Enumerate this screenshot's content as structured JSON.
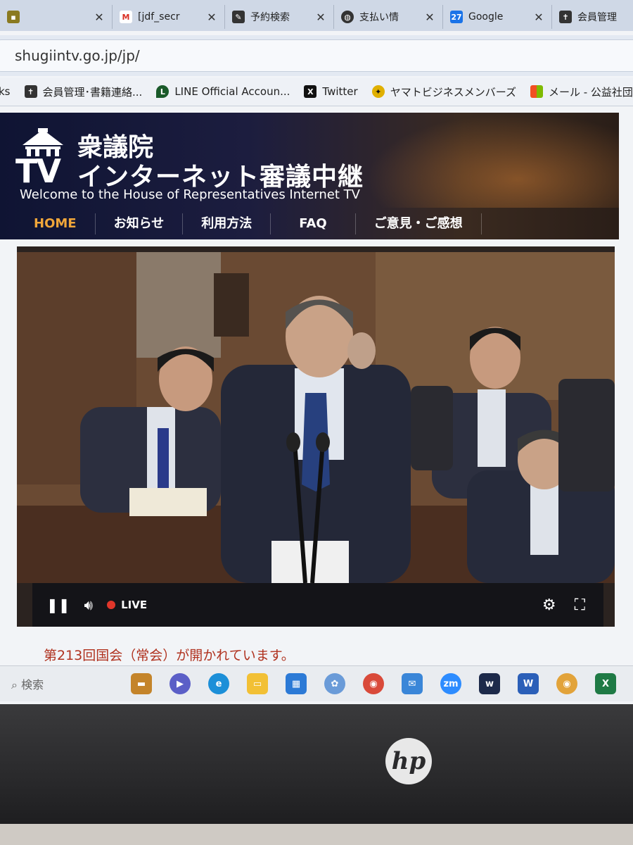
{
  "browser": {
    "tabs": [
      {
        "label": "",
        "icon": "chat-icon",
        "color": "#7a6a1a"
      },
      {
        "label": "[jdf_secr",
        "icon": "gmail-icon",
        "color": "#d93025"
      },
      {
        "label": "予約検索",
        "icon": "pen-icon",
        "color": "#333333"
      },
      {
        "label": "支払い情",
        "icon": "globe-icon",
        "color": "#333333"
      },
      {
        "label": "Google",
        "icon": "calendar-icon",
        "color": "#1a73e8",
        "badge": "27"
      },
      {
        "label": "会員管理",
        "icon": "cross-icon",
        "color": "#333333"
      }
    ],
    "url": "shugiintv.go.jp/jp/",
    "bookmarks": [
      {
        "label": "ks",
        "icon": ""
      },
      {
        "label": "会員管理･書籍連絡...",
        "icon": "cross-icon",
        "color": "#333333"
      },
      {
        "label": "LINE Official Accoun...",
        "icon": "line-icon",
        "color": "#1a5a2a"
      },
      {
        "label": "Twitter",
        "icon": "x-icon",
        "color": "#111111"
      },
      {
        "label": "ヤマトビジネスメンバーズ",
        "icon": "yamato-icon",
        "color": "#e0b000"
      },
      {
        "label": "メール - 公益社団法",
        "icon": "microsoft-icon",
        "color": "#f25022"
      }
    ]
  },
  "site": {
    "logo_tv": "TV",
    "title_line1": "衆議院",
    "title_line2": "インターネット審議中継",
    "subtitle": "Welcome to the House of Representatives Internet TV",
    "nav": [
      {
        "label": "HOME",
        "active": true
      },
      {
        "label": "お知らせ",
        "active": false
      },
      {
        "label": "利用方法",
        "active": false
      },
      {
        "label": "FAQ",
        "active": false
      },
      {
        "label": "ご意見・ご感想",
        "active": false
      }
    ]
  },
  "player": {
    "live_label": "LIVE",
    "status": "live"
  },
  "notice": "第213回国会（常会）が開かれています。",
  "taskbar": {
    "search_label": "検索",
    "apps": [
      "briefcase-icon",
      "meet-icon",
      "edge-icon",
      "explorer-icon",
      "store-icon",
      "copilot-icon",
      "chrome-icon",
      "mail-icon",
      "zoom-icon",
      "webex-icon",
      "word-icon",
      "chrome-profile-icon",
      "excel-icon"
    ]
  },
  "device": {
    "brand": "hp"
  }
}
